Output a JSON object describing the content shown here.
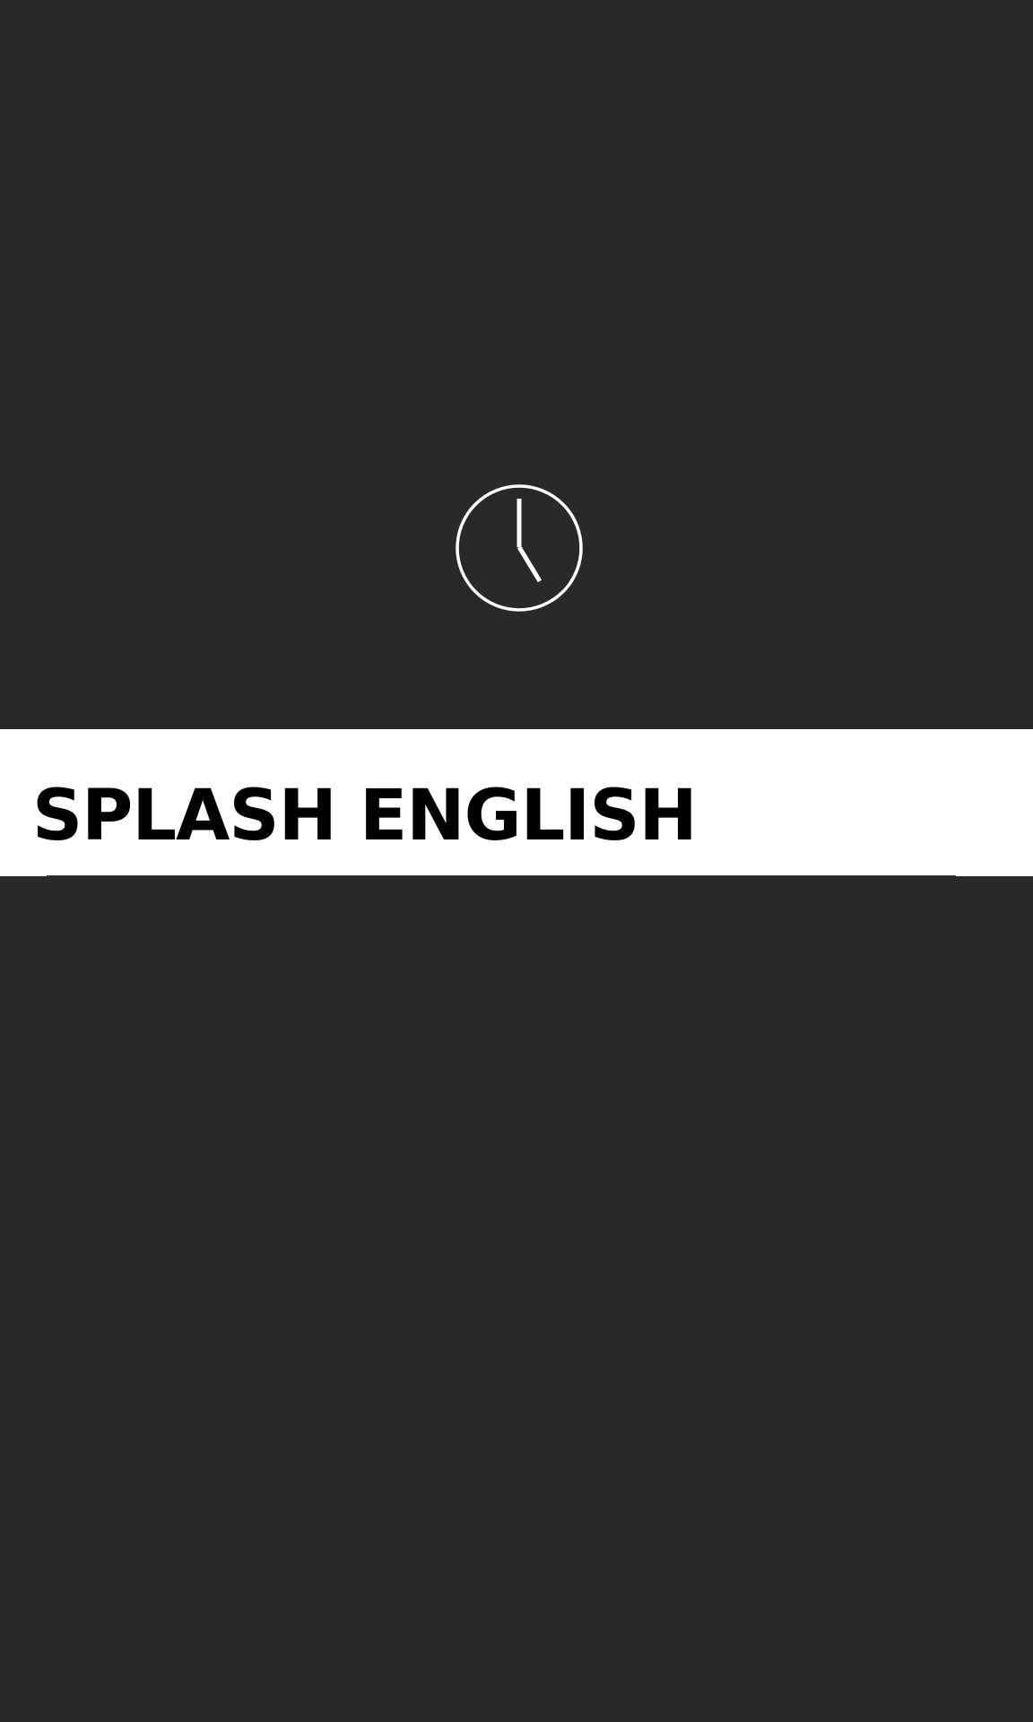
{
  "splash": {
    "icon": "clock-icon",
    "title": "SPLASH ENGLISH"
  },
  "colors": {
    "background": "#292929",
    "banner": "#ffffff",
    "title_text": "#000000",
    "icon_stroke": "#ffffff"
  }
}
